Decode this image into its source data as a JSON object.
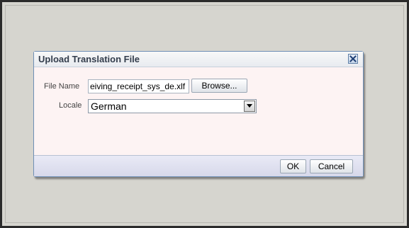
{
  "dialog": {
    "title": "Upload Translation File",
    "close_icon": "close-icon"
  },
  "form": {
    "file_name_label": "File Name",
    "file_name_value": "eiving_receipt_sys_de.xlf",
    "browse_label": "Browse...",
    "locale_label": "Locale",
    "locale_value": "German",
    "locale_arrow_icon": "chevron-down-icon"
  },
  "footer": {
    "ok_label": "OK",
    "cancel_label": "Cancel"
  }
}
